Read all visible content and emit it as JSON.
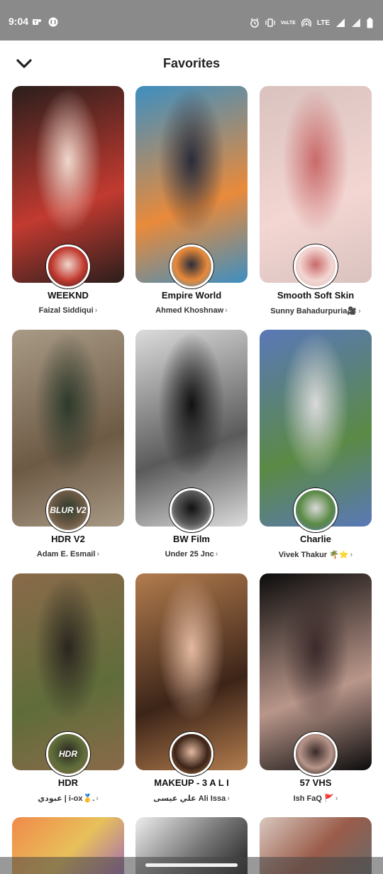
{
  "status_bar": {
    "time": "9:04",
    "network_small": "VoLTE",
    "network": "LTE",
    "icons": [
      "teams-icon",
      "shazam-icon",
      "alarm-icon",
      "vibrate-icon",
      "hotspot-icon",
      "signal-icon",
      "battery-icon"
    ]
  },
  "header": {
    "title": "Favorites",
    "back_icon": "chevron-down-icon"
  },
  "lenses": [
    {
      "name": "WEEKND",
      "creator": "Faizal Siddiqui",
      "colors": [
        "#2a1e1c",
        "#c23a30",
        "#f0d7cc"
      ]
    },
    {
      "name": "Empire World",
      "creator": "Ahmed Khoshnaw",
      "colors": [
        "#3d8fc2",
        "#e98a3a",
        "#2a2c3a"
      ]
    },
    {
      "name": "Smooth Soft Skin",
      "creator": "Sunny Bahadurpuria🎥",
      "colors": [
        "#d9c2bf",
        "#f3d6d2",
        "#c96a6a"
      ]
    },
    {
      "name": "HDR V2",
      "creator": "Adam E. Esmail",
      "avatar_text": "BLUR V2",
      "colors": [
        "#a89a86",
        "#6d5a45",
        "#2d3a2b"
      ]
    },
    {
      "name": "BW Film",
      "creator": "Under 25 Jnc",
      "colors": [
        "#dcdcdc",
        "#5a5a5a",
        "#111111"
      ]
    },
    {
      "name": "Charlie",
      "creator": "Vivek Thakur 🌴⭐",
      "colors": [
        "#5a78b8",
        "#5b8a45",
        "#d9d9d9"
      ]
    },
    {
      "name": "HDR",
      "creator": "عبودي | i-ox🥇.",
      "avatar_text": "HDR",
      "colors": [
        "#8a6a4a",
        "#5f6d3a",
        "#2b2620"
      ]
    },
    {
      "name": "MAKEUP - 3 A L I",
      "creator": "علي عيسى Ali Issa",
      "colors": [
        "#b27c4e",
        "#3c2418",
        "#e3b9a0"
      ]
    },
    {
      "name": "57 VHS",
      "creator": "Ish FaQ 🚩",
      "colors": [
        "#0c0c0c",
        "#b9968a",
        "#3a2a2a"
      ]
    }
  ],
  "partial_cards": [
    {
      "colors": [
        "#f08a4a",
        "#e8c05a",
        "#a56fb0"
      ]
    },
    {
      "colors": [
        "#eeeeee",
        "#777777",
        "#222222"
      ]
    },
    {
      "colors": [
        "#d9c8bf",
        "#9a5c4a",
        "#6a6a6a"
      ]
    }
  ],
  "chevron": "›",
  "accent": "#222222"
}
